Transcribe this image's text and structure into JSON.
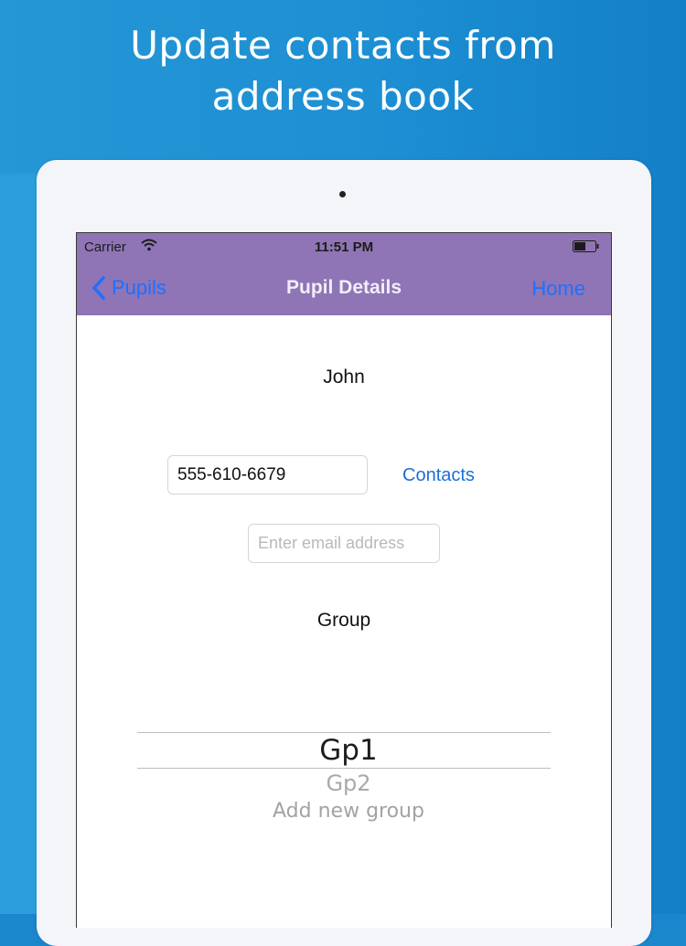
{
  "promo": {
    "headline_line1": "Update contacts from",
    "headline_line2": "address book"
  },
  "status_bar": {
    "carrier": "Carrier",
    "time": "11:51 PM",
    "icons": [
      "wifi-icon",
      "battery-icon"
    ]
  },
  "nav_bar": {
    "back_label": "Pupils",
    "back_icon": "chevron-left-icon",
    "title": "Pupil Details",
    "home_label": "Home",
    "accent_color": "#1f6fff",
    "bar_color": "#8f75b5"
  },
  "form": {
    "name": "John",
    "phone_value": "555-610-6679",
    "contacts_label": "Contacts",
    "email_value": "",
    "email_placeholder": "Enter email address",
    "group_label": "Group"
  },
  "picker": {
    "selected": "Gp1",
    "options": [
      "Gp1",
      "Gp2",
      "Add new group"
    ]
  }
}
